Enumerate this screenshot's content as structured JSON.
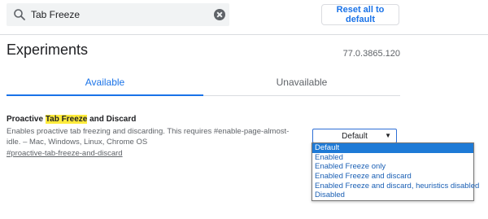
{
  "search": {
    "value": "Tab Freeze"
  },
  "header": {
    "reset_label": "Reset all to default"
  },
  "page": {
    "title": "Experiments",
    "version": "77.0.3865.120"
  },
  "tabs": [
    {
      "label": "Available"
    },
    {
      "label": "Unavailable"
    }
  ],
  "experiment": {
    "title_before": "Proactive ",
    "title_highlight": "Tab Freeze",
    "title_after": " and Discard",
    "description": "Enables proactive tab freezing and discarding. This requires #enable-page-almost-idle. – Mac, Windows, Linux, Chrome OS",
    "link": "#proactive-tab-freeze-and-discard",
    "select_value": "Default",
    "options": [
      "Default",
      "Enabled",
      "Enabled Freeze only",
      "Enabled Freeze and discard",
      "Enabled Freeze and discard, heuristics disabled",
      "Disabled"
    ]
  },
  "colors": {
    "accent": "#1a73e8",
    "highlight": "#ffeb3b",
    "selected_option": "#1e7ad6"
  }
}
